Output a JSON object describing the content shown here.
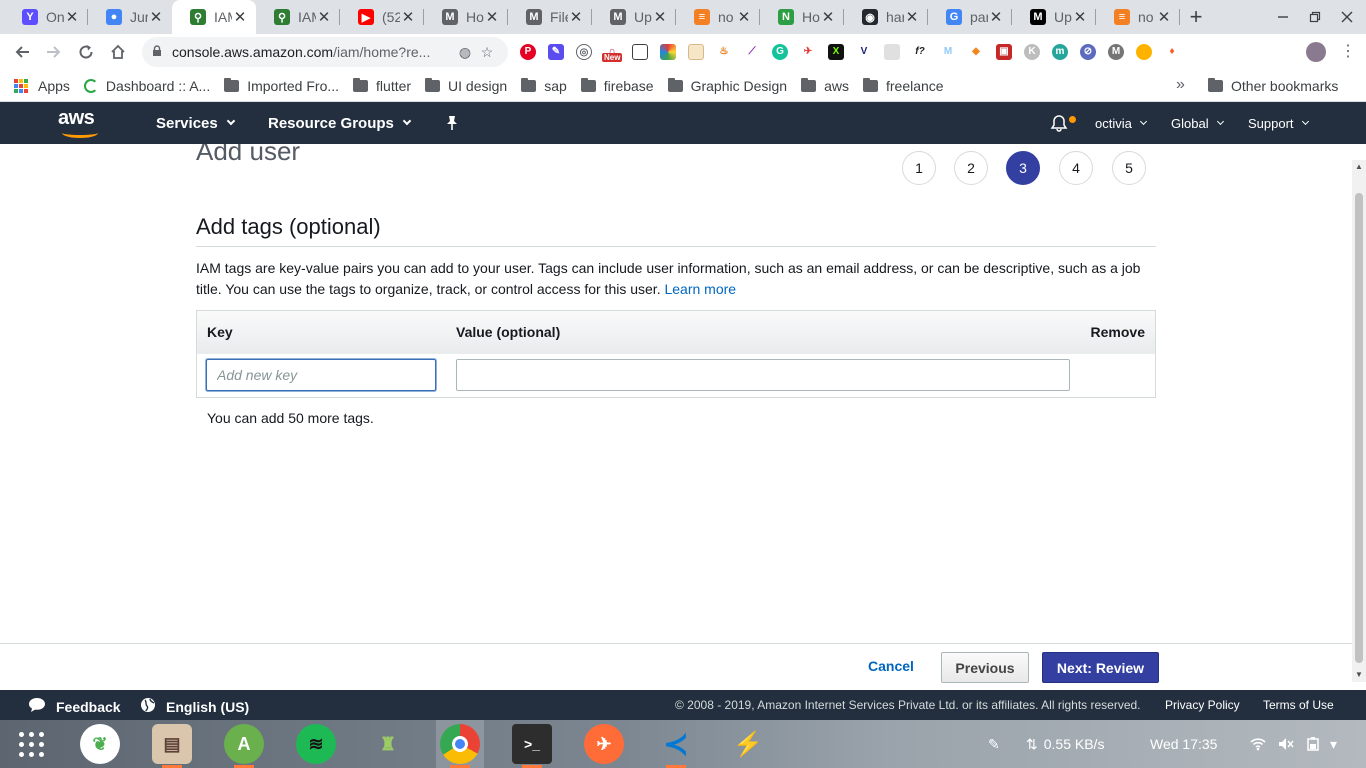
{
  "browser": {
    "tabs": [
      {
        "title": "On",
        "icon_color": "#5d4fff",
        "icon_glyph": "Y"
      },
      {
        "title": "Jur",
        "icon_color": "#4285f4",
        "icon_glyph": "●"
      },
      {
        "title": "IAM",
        "icon_color": "#2e7d32",
        "icon_glyph": "⚲",
        "active": true
      },
      {
        "title": "IAM",
        "icon_color": "#2e7d32",
        "icon_glyph": "⚲"
      },
      {
        "title": "(52",
        "icon_color": "#ff0000",
        "icon_glyph": "▶"
      },
      {
        "title": "Ho",
        "icon_color": "#5f6368",
        "icon_glyph": "M"
      },
      {
        "title": "File",
        "icon_color": "#5f6368",
        "icon_glyph": "M"
      },
      {
        "title": "Up",
        "icon_color": "#5f6368",
        "icon_glyph": "M"
      },
      {
        "title": "no",
        "icon_color": "#f48024",
        "icon_glyph": "≡"
      },
      {
        "title": "Ho",
        "icon_color": "#2e9e44",
        "icon_glyph": "N"
      },
      {
        "title": "har",
        "icon_color": "#24292e",
        "icon_glyph": "◉"
      },
      {
        "title": "par",
        "icon_color": "#4285f4",
        "icon_glyph": "G"
      },
      {
        "title": "Up",
        "icon_color": "#000000",
        "icon_glyph": "M"
      },
      {
        "title": "no",
        "icon_color": "#f48024",
        "icon_glyph": "≡"
      }
    ],
    "new_tab_label": "+",
    "url_host": "console.aws.amazon.com",
    "url_path": "/iam/home?re...",
    "bookmarks": [
      {
        "label": "Apps",
        "kind": "apps"
      },
      {
        "label": "Dashboard :: A...",
        "kind": "ring"
      },
      {
        "label": "Imported Fro...",
        "kind": "folder"
      },
      {
        "label": "flutter",
        "kind": "folder"
      },
      {
        "label": "UI design",
        "kind": "folder"
      },
      {
        "label": "sap",
        "kind": "folder"
      },
      {
        "label": "firebase",
        "kind": "folder"
      },
      {
        "label": "Graphic Design",
        "kind": "folder"
      },
      {
        "label": "aws",
        "kind": "folder"
      },
      {
        "label": "freelance",
        "kind": "folder"
      }
    ],
    "bookmarks_more": "»",
    "other_bookmarks": "Other bookmarks",
    "new_badge": "New"
  },
  "aws_header": {
    "logo_text": "aws",
    "services_label": "Services",
    "resource_groups_label": "Resource Groups",
    "user_label": "octivia",
    "region_label": "Global",
    "support_label": "Support",
    "accent_color": "#ff9900"
  },
  "wizard": {
    "page_title": "Add user",
    "steps": [
      "1",
      "2",
      "3",
      "4",
      "5"
    ],
    "active_step": "3",
    "section_title": "Add tags (optional)",
    "description": "IAM tags are key-value pairs you can add to your user. Tags can include user information, such as an email address, or can be descriptive, such as a job title. You can use the tags to organize, track, or control access for this user.",
    "learn_more": "Learn more",
    "table": {
      "col_key": "Key",
      "col_value": "Value (optional)",
      "col_remove": "Remove",
      "key_placeholder": "Add new key",
      "key_value": "",
      "value_value": ""
    },
    "remaining_text": "You can add 50 more tags.",
    "cancel_label": "Cancel",
    "previous_label": "Previous",
    "next_label": "Next: Review",
    "primary_color": "#333fa1"
  },
  "aws_footer": {
    "feedback_label": "Feedback",
    "language_label": "English (US)",
    "copyright": "© 2008 - 2019, Amazon Internet Services Private Ltd. or its affiliates. All rights reserved.",
    "privacy_label": "Privacy Policy",
    "terms_label": "Terms of Use"
  },
  "taskbar": {
    "network_speed": "0.55 KB/s",
    "clock": "Wed 17:35"
  }
}
